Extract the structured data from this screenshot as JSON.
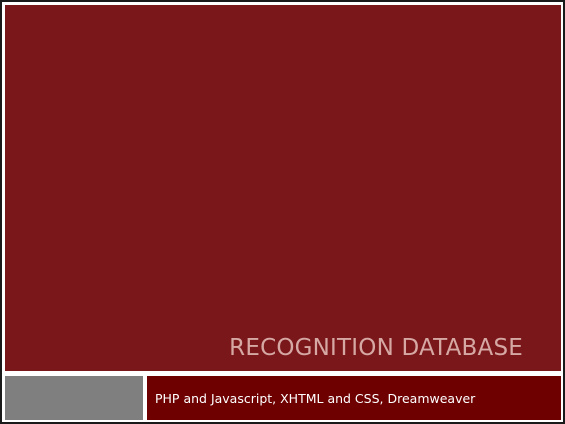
{
  "slide": {
    "title": "RECOGNITION DATABASE",
    "subtitle": "PHP and Javascript, XHTML and CSS, Dreamweaver"
  },
  "colors": {
    "title_panel": "#7a171b",
    "title_text": "#d6a8a3",
    "subtitle_bar": "#6e0000",
    "subtitle_text": "#ffffff",
    "accent_block": "#7f7f7f"
  }
}
